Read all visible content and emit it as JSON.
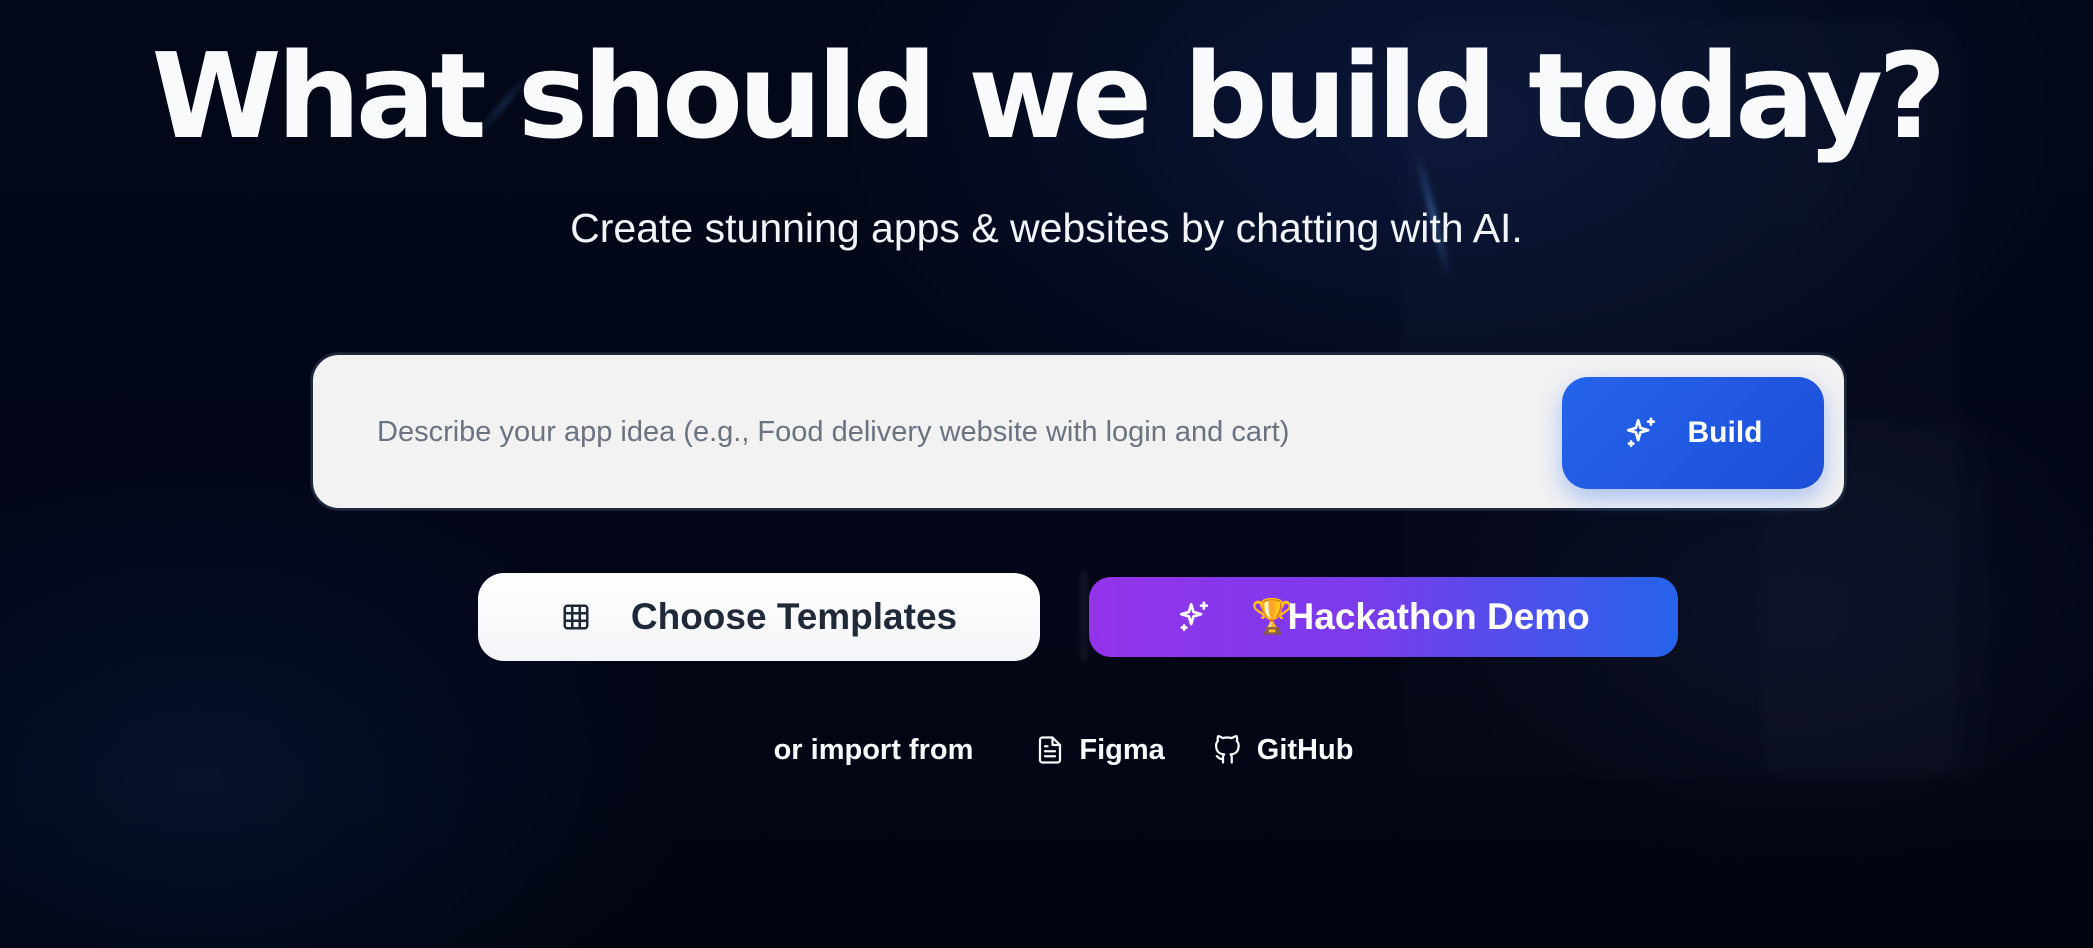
{
  "hero": {
    "title": "What should we build today?",
    "subtitle": "Create stunning apps & websites by chatting with AI."
  },
  "prompt": {
    "placeholder": "Describe your app idea (e.g., Food delivery website with login and cart)",
    "value": "",
    "build_label": "Build",
    "build_icon": "sparkles-icon"
  },
  "actions": {
    "templates_label": "Choose Templates",
    "templates_icon": "grid-icon",
    "hackathon_label": "Hackathon Demo",
    "hackathon_emoji": "🏆",
    "hackathon_icon": "sparkles-icon"
  },
  "import": {
    "label": "or import from",
    "figma_label": "Figma",
    "figma_icon": "file-icon",
    "github_label": "GitHub",
    "github_icon": "github-icon"
  },
  "colors": {
    "background": "#020617",
    "build_button": "#2563eb",
    "hackathon_gradient_start": "#9333ea",
    "hackathon_gradient_end": "#2563eb",
    "text_primary": "#f8fafc"
  }
}
